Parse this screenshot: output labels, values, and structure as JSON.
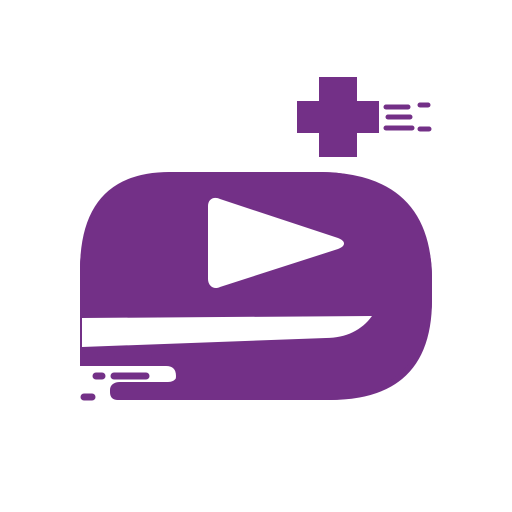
{
  "colors": {
    "background": "#ffffff",
    "brand": "#733087",
    "play": "#ffffff"
  },
  "icons": {
    "logo": "play-plus-logo-icon",
    "plus": "plus-icon",
    "play": "play-icon",
    "speed_lines": "speed-lines-icon"
  }
}
